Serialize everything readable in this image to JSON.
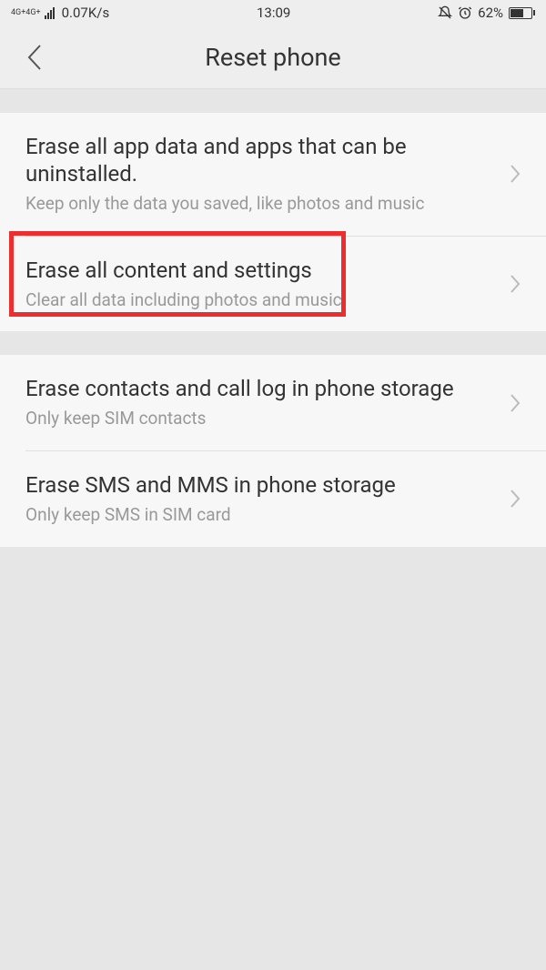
{
  "statusbar": {
    "network_label_top": "4G+4G+",
    "speed": "0.07K/s",
    "time": "13:09",
    "battery_percent": "62%"
  },
  "header": {
    "title": "Reset phone"
  },
  "section1": {
    "items": [
      {
        "title": "Erase all app data and apps that can be uninstalled.",
        "subtitle": "Keep only the data you saved, like photos and music"
      },
      {
        "title": "Erase all content and settings",
        "subtitle": "Clear all data including photos and music"
      }
    ]
  },
  "section2": {
    "items": [
      {
        "title": "Erase contacts and call log in phone storage",
        "subtitle": "Only keep SIM contacts"
      },
      {
        "title": "Erase SMS and MMS in phone storage",
        "subtitle": "Only keep SMS in SIM card"
      }
    ]
  }
}
